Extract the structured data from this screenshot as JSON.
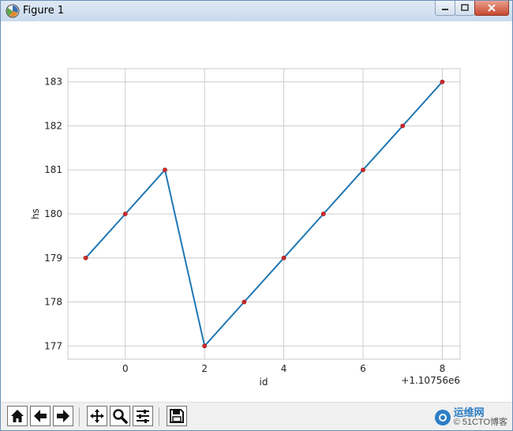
{
  "window": {
    "title": "Figure 1"
  },
  "chart_data": {
    "type": "line",
    "x": [
      -1,
      0,
      1,
      2,
      3,
      4,
      5,
      6,
      7,
      8
    ],
    "series": [
      {
        "values": [
          179,
          180,
          181,
          177,
          178,
          179,
          180,
          181,
          182,
          183
        ],
        "color": "#1f77b4",
        "marker_color": "#d62728"
      }
    ],
    "xlabel": "id",
    "ylabel": "hs",
    "x_offset_label": "+1.10756e6",
    "xlim": [
      -1.45,
      8.45
    ],
    "ylim": [
      176.7,
      183.3
    ],
    "xticks": [
      0,
      2,
      4,
      6,
      8
    ],
    "yticks": [
      177,
      178,
      179,
      180,
      181,
      182,
      183
    ],
    "grid": true
  },
  "toolbar": {
    "buttons": [
      "home-icon",
      "back-icon",
      "forward-icon",
      "pan-icon",
      "zoom-icon",
      "configure-icon",
      "save-icon"
    ]
  },
  "watermark": {
    "top": "运维网",
    "bottom": "© 51CTO博客"
  }
}
